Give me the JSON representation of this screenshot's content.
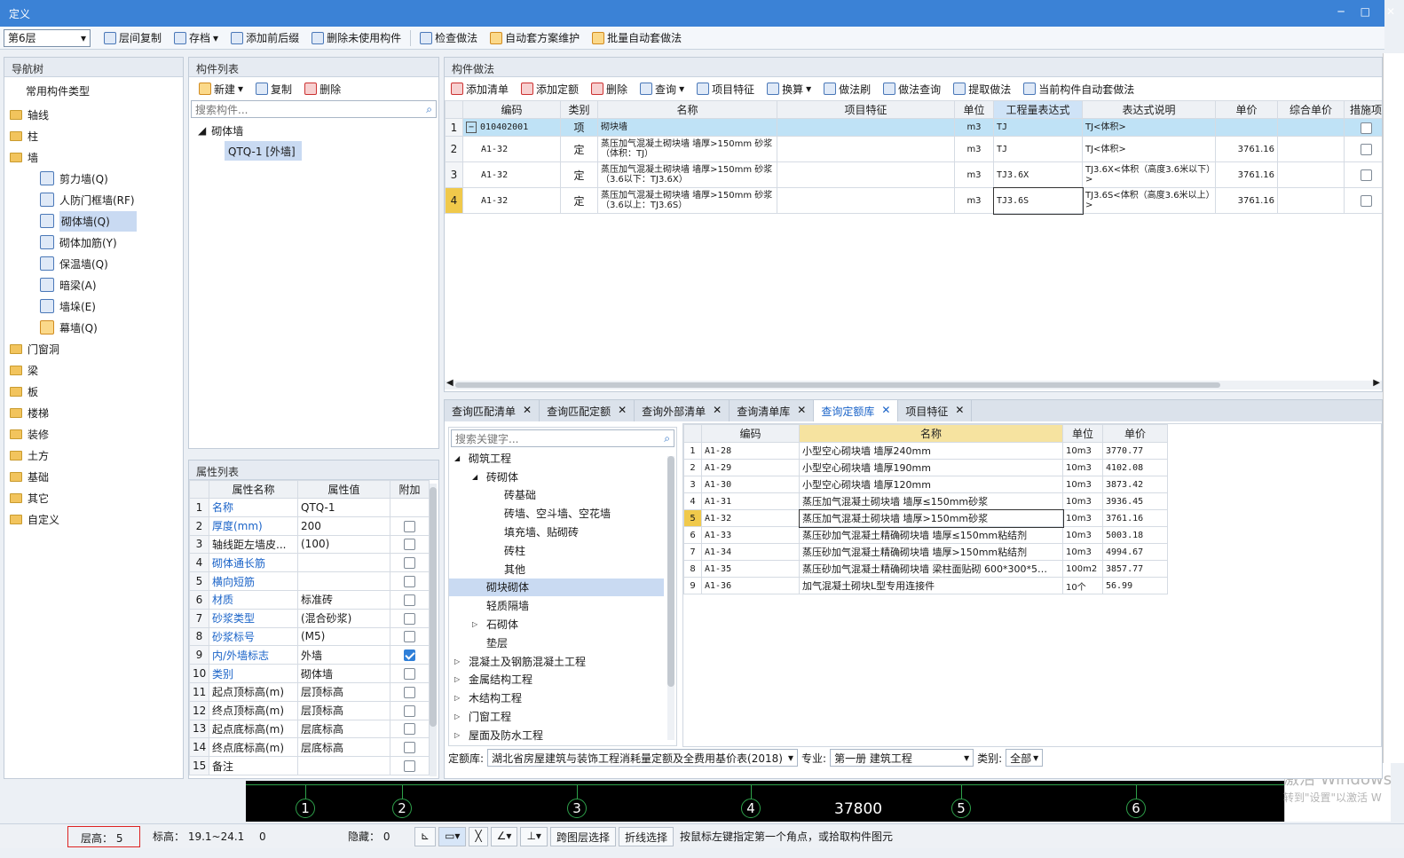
{
  "window": {
    "title": "定义",
    "minimize": "─",
    "maximize": "□",
    "close": "✕"
  },
  "toolbar": {
    "floor": "第6层",
    "buttons": [
      "层间复制",
      "存档",
      "添加前后缀",
      "删除未使用构件",
      "检查做法",
      "自动套方案维护",
      "批量自动套做法"
    ]
  },
  "nav": {
    "title": "导航树",
    "root": "常用构件类型",
    "items": [
      {
        "label": "轴线",
        "level": 0
      },
      {
        "label": "柱",
        "level": 0
      },
      {
        "label": "墙",
        "level": 0,
        "open": true
      },
      {
        "label": "剪力墙(Q)",
        "level": 1
      },
      {
        "label": "人防门框墙(RF)",
        "level": 1
      },
      {
        "label": "砌体墙(Q)",
        "level": 1,
        "selected": true
      },
      {
        "label": "砌体加筋(Y)",
        "level": 1
      },
      {
        "label": "保温墙(Q)",
        "level": 1
      },
      {
        "label": "暗梁(A)",
        "level": 1
      },
      {
        "label": "墙垛(E)",
        "level": 1
      },
      {
        "label": "幕墙(Q)",
        "level": 1
      },
      {
        "label": "门窗洞",
        "level": 0
      },
      {
        "label": "梁",
        "level": 0
      },
      {
        "label": "板",
        "level": 0
      },
      {
        "label": "楼梯",
        "level": 0
      },
      {
        "label": "装修",
        "level": 0
      },
      {
        "label": "土方",
        "level": 0
      },
      {
        "label": "基础",
        "level": 0
      },
      {
        "label": "其它",
        "level": 0
      },
      {
        "label": "自定义",
        "level": 0
      }
    ]
  },
  "component_list": {
    "title": "构件列表",
    "new": "新建",
    "copy": "复制",
    "delete": "删除",
    "search_placeholder": "搜索构件...",
    "group": "砌体墙",
    "item": "QTQ-1 [外墙]"
  },
  "properties": {
    "title": "属性列表",
    "headers": [
      "属性名称",
      "属性值",
      "附加"
    ],
    "rows": [
      {
        "no": "1",
        "name": "名称",
        "value": "QTQ-1",
        "blue": true,
        "check": null
      },
      {
        "no": "2",
        "name": "厚度(mm)",
        "value": "200",
        "blue": true,
        "check": false
      },
      {
        "no": "3",
        "name": "轴线距左墙皮...",
        "value": "(100)",
        "blue": false,
        "check": false
      },
      {
        "no": "4",
        "name": "砌体通长筋",
        "value": "",
        "blue": true,
        "check": false
      },
      {
        "no": "5",
        "name": "横向短筋",
        "value": "",
        "blue": true,
        "check": false
      },
      {
        "no": "6",
        "name": "材质",
        "value": "标准砖",
        "blue": true,
        "check": false
      },
      {
        "no": "7",
        "name": "砂浆类型",
        "value": "(混合砂浆)",
        "blue": true,
        "check": false
      },
      {
        "no": "8",
        "name": "砂浆标号",
        "value": "(M5)",
        "blue": true,
        "check": false
      },
      {
        "no": "9",
        "name": "内/外墙标志",
        "value": "外墙",
        "blue": true,
        "check": true
      },
      {
        "no": "10",
        "name": "类别",
        "value": "砌体墙",
        "blue": true,
        "check": false
      },
      {
        "no": "11",
        "name": "起点顶标高(m)",
        "value": "层顶标高",
        "blue": false,
        "check": false
      },
      {
        "no": "12",
        "name": "终点顶标高(m)",
        "value": "层顶标高",
        "blue": false,
        "check": false
      },
      {
        "no": "13",
        "name": "起点底标高(m)",
        "value": "层底标高",
        "blue": false,
        "check": false
      },
      {
        "no": "14",
        "name": "终点底标高(m)",
        "value": "层底标高",
        "blue": false,
        "check": false
      },
      {
        "no": "15",
        "name": "备注",
        "value": "",
        "blue": false,
        "check": false
      }
    ]
  },
  "method": {
    "title": "构件做法",
    "tools": [
      "添加清单",
      "添加定额",
      "删除",
      "查询",
      "项目特征",
      "换算",
      "做法刷",
      "做法查询",
      "提取做法",
      "当前构件自动套做法"
    ],
    "headers": [
      "编码",
      "类别",
      "名称",
      "项目特征",
      "单位",
      "工程量表达式",
      "表达式说明",
      "单价",
      "综合单价",
      "措施项"
    ],
    "rows": [
      {
        "no": "1",
        "code": "010402001",
        "type": "项",
        "name": "砌块墙",
        "unit": "m3",
        "expr": "TJ",
        "desc": "TJ<体积>",
        "price": ""
      },
      {
        "no": "2",
        "code": "A1-32",
        "type": "定",
        "name": "蒸压加气混凝土砌块墙 墙厚>150mm 砂浆（体积：TJ）",
        "unit": "m3",
        "expr": "TJ",
        "desc": "TJ<体积>",
        "price": "3761.16"
      },
      {
        "no": "3",
        "code": "A1-32",
        "type": "定",
        "name": "蒸压加气混凝土砌块墙 墙厚>150mm 砂浆（3.6以下：TJ3.6X）",
        "unit": "m3",
        "expr": "TJ3.6X",
        "desc": "TJ3.6X<体积（高度3.6米以下）>",
        "price": "3761.16"
      },
      {
        "no": "4",
        "code": "A1-32",
        "type": "定",
        "name": "蒸压加气混凝土砌块墙 墙厚>150mm 砂浆（3.6以上：TJ3.6S）",
        "unit": "m3",
        "expr": "TJ3.6S",
        "desc": "TJ3.6S<体积（高度3.6米以上）>",
        "price": "3761.16"
      }
    ]
  },
  "query": {
    "tabs": [
      "查询匹配清单",
      "查询匹配定额",
      "查询外部清单",
      "查询清单库",
      "查询定额库",
      "项目特征"
    ],
    "active_tab": 4,
    "search_placeholder": "搜索关键字...",
    "tree": [
      {
        "label": "砌筑工程",
        "level": 0,
        "arrow": "◢"
      },
      {
        "label": "砖砌体",
        "level": 1,
        "arrow": "◢"
      },
      {
        "label": "砖基础",
        "level": 2,
        "arrow": ""
      },
      {
        "label": "砖墙、空斗墙、空花墙",
        "level": 2,
        "arrow": ""
      },
      {
        "label": "填充墙、贴砌砖",
        "level": 2,
        "arrow": ""
      },
      {
        "label": "砖柱",
        "level": 2,
        "arrow": ""
      },
      {
        "label": "其他",
        "level": 2,
        "arrow": ""
      },
      {
        "label": "砌块砌体",
        "level": 1,
        "arrow": "",
        "selected": true
      },
      {
        "label": "轻质隔墙",
        "level": 1,
        "arrow": ""
      },
      {
        "label": "石砌体",
        "level": 1,
        "arrow": "▷"
      },
      {
        "label": "垫层",
        "level": 1,
        "arrow": ""
      },
      {
        "label": "混凝土及钢筋混凝土工程",
        "level": 0,
        "arrow": "▷"
      },
      {
        "label": "金属结构工程",
        "level": 0,
        "arrow": "▷"
      },
      {
        "label": "木结构工程",
        "level": 0,
        "arrow": "▷"
      },
      {
        "label": "门窗工程",
        "level": 0,
        "arrow": "▷"
      },
      {
        "label": "屋面及防水工程",
        "level": 0,
        "arrow": "▷"
      }
    ],
    "headers": [
      "编码",
      "名称",
      "单位",
      "单价"
    ],
    "rows": [
      {
        "no": "1",
        "code": "A1-28",
        "name": "小型空心砌块墙 墙厚240mm",
        "unit": "10m3",
        "price": "3770.77"
      },
      {
        "no": "2",
        "code": "A1-29",
        "name": "小型空心砌块墙 墙厚190mm",
        "unit": "10m3",
        "price": "4102.08"
      },
      {
        "no": "3",
        "code": "A1-30",
        "name": "小型空心砌块墙 墙厚120mm",
        "unit": "10m3",
        "price": "3873.42"
      },
      {
        "no": "4",
        "code": "A1-31",
        "name": "蒸压加气混凝土砌块墙 墙厚≤150mm砂浆",
        "unit": "10m3",
        "price": "3936.45"
      },
      {
        "no": "5",
        "code": "A1-32",
        "name": "蒸压加气混凝土砌块墙 墙厚>150mm砂浆",
        "unit": "10m3",
        "price": "3761.16"
      },
      {
        "no": "6",
        "code": "A1-33",
        "name": "蒸压砂加气混凝土精确砌块墙 墙厚≤150mm粘结剂",
        "unit": "10m3",
        "price": "5003.18"
      },
      {
        "no": "7",
        "code": "A1-34",
        "name": "蒸压砂加气混凝土精确砌块墙 墙厚>150mm粘结剂",
        "unit": "10m3",
        "price": "4994.67"
      },
      {
        "no": "8",
        "code": "A1-35",
        "name": "蒸压砂加气混凝土精确砌块墙 梁柱面贴砌 600*300*5…",
        "unit": "100m2",
        "price": "3857.77"
      },
      {
        "no": "9",
        "code": "A1-36",
        "name": "加气混凝土砌块L型专用连接件",
        "unit": "10个",
        "price": "56.99"
      }
    ],
    "quota_label": "定额库:",
    "quota_value": "湖北省房屋建筑与装饰工程消耗量定额及全费用基价表(2018)",
    "major_label": "专业:",
    "major_value": "第一册 建筑工程",
    "cat_label": "类别:",
    "cat_value": "全部"
  },
  "canvas": {
    "axes": [
      "1",
      "2",
      "3",
      "4",
      "5",
      "6"
    ],
    "dimension": "37800",
    "watermark1": "激活 Windows",
    "watermark2": "转到\"设置\"以激活 W"
  },
  "status": {
    "floor_height": "层高：  5",
    "elevation": "标高：  19.1~24.1",
    "zero": "0",
    "hidden": "隐藏：  0",
    "cross_select": "跨图层选择",
    "line_select": "折线选择",
    "hint": "按鼠标左键指定第一个角点，或拾取构件图元"
  }
}
